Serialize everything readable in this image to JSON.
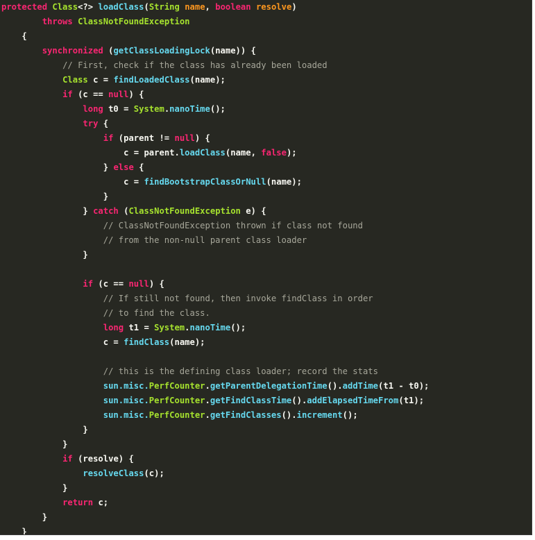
{
  "editor": {
    "lines": [
      [
        {
          "t": "protected ",
          "s": "k"
        },
        {
          "t": "Class",
          "s": "t"
        },
        {
          "t": "<?> ",
          "s": "d"
        },
        {
          "t": "loadClass",
          "s": "f"
        },
        {
          "t": "(",
          "s": "d"
        },
        {
          "t": "String ",
          "s": "t"
        },
        {
          "t": "name",
          "s": "p"
        },
        {
          "t": ", ",
          "s": "d"
        },
        {
          "t": "boolean ",
          "s": "k"
        },
        {
          "t": "resolve",
          "s": "p"
        },
        {
          "t": ")",
          "s": "d"
        }
      ],
      [
        {
          "t": "        ",
          "s": "d"
        },
        {
          "t": "throws ",
          "s": "k"
        },
        {
          "t": "ClassNotFoundException",
          "s": "t"
        }
      ],
      [
        {
          "t": "    {",
          "s": "d"
        }
      ],
      [
        {
          "t": "        ",
          "s": "d"
        },
        {
          "t": "synchronized ",
          "s": "k"
        },
        {
          "t": "(",
          "s": "d"
        },
        {
          "t": "getClassLoadingLock",
          "s": "f"
        },
        {
          "t": "(name)) {",
          "s": "d"
        }
      ],
      [
        {
          "t": "            ",
          "s": "d"
        },
        {
          "t": "// First, check if the class has already been loaded",
          "s": "c"
        }
      ],
      [
        {
          "t": "            ",
          "s": "d"
        },
        {
          "t": "Class ",
          "s": "t"
        },
        {
          "t": "c = ",
          "s": "d"
        },
        {
          "t": "findLoadedClass",
          "s": "f"
        },
        {
          "t": "(name);",
          "s": "d"
        }
      ],
      [
        {
          "t": "            ",
          "s": "d"
        },
        {
          "t": "if ",
          "s": "k"
        },
        {
          "t": "(c == ",
          "s": "d"
        },
        {
          "t": "null",
          "s": "k"
        },
        {
          "t": ") {",
          "s": "d"
        }
      ],
      [
        {
          "t": "                ",
          "s": "d"
        },
        {
          "t": "long ",
          "s": "k"
        },
        {
          "t": "t0 = ",
          "s": "d"
        },
        {
          "t": "System",
          "s": "t"
        },
        {
          "t": ".",
          "s": "d"
        },
        {
          "t": "nanoTime",
          "s": "f"
        },
        {
          "t": "();",
          "s": "d"
        }
      ],
      [
        {
          "t": "                ",
          "s": "d"
        },
        {
          "t": "try ",
          "s": "k"
        },
        {
          "t": "{",
          "s": "d"
        }
      ],
      [
        {
          "t": "                    ",
          "s": "d"
        },
        {
          "t": "if ",
          "s": "k"
        },
        {
          "t": "(parent != ",
          "s": "d"
        },
        {
          "t": "null",
          "s": "k"
        },
        {
          "t": ") {",
          "s": "d"
        }
      ],
      [
        {
          "t": "                        ",
          "s": "d"
        },
        {
          "t": "c = ",
          "s": "d"
        },
        {
          "t": "parent",
          "s": "d"
        },
        {
          "t": ".",
          "s": "d"
        },
        {
          "t": "loadClass",
          "s": "f"
        },
        {
          "t": "(name, ",
          "s": "d"
        },
        {
          "t": "false",
          "s": "k"
        },
        {
          "t": ");",
          "s": "d"
        }
      ],
      [
        {
          "t": "                    } ",
          "s": "d"
        },
        {
          "t": "else ",
          "s": "k"
        },
        {
          "t": "{",
          "s": "d"
        }
      ],
      [
        {
          "t": "                        ",
          "s": "d"
        },
        {
          "t": "c = ",
          "s": "d"
        },
        {
          "t": "findBootstrapClassOrNull",
          "s": "f"
        },
        {
          "t": "(name);",
          "s": "d"
        }
      ],
      [
        {
          "t": "                    }",
          "s": "d"
        }
      ],
      [
        {
          "t": "                } ",
          "s": "d"
        },
        {
          "t": "catch ",
          "s": "k"
        },
        {
          "t": "(",
          "s": "d"
        },
        {
          "t": "ClassNotFoundException ",
          "s": "t"
        },
        {
          "t": "e) {",
          "s": "d"
        }
      ],
      [
        {
          "t": "                    ",
          "s": "d"
        },
        {
          "t": "// ClassNotFoundException thrown if class not found",
          "s": "c"
        }
      ],
      [
        {
          "t": "                    ",
          "s": "d"
        },
        {
          "t": "// from the non-null parent class loader",
          "s": "c"
        }
      ],
      [
        {
          "t": "                }",
          "s": "d"
        }
      ],
      [
        {
          "t": "",
          "s": "d"
        }
      ],
      [
        {
          "t": "                ",
          "s": "d"
        },
        {
          "t": "if ",
          "s": "k"
        },
        {
          "t": "(c == ",
          "s": "d"
        },
        {
          "t": "null",
          "s": "k"
        },
        {
          "t": ") {",
          "s": "d"
        }
      ],
      [
        {
          "t": "                    ",
          "s": "d"
        },
        {
          "t": "// If still not found, then invoke findClass in order",
          "s": "c"
        }
      ],
      [
        {
          "t": "                    ",
          "s": "d"
        },
        {
          "t": "// to find the class.",
          "s": "c"
        }
      ],
      [
        {
          "t": "                    ",
          "s": "d"
        },
        {
          "t": "long ",
          "s": "k"
        },
        {
          "t": "t1 = ",
          "s": "d"
        },
        {
          "t": "System",
          "s": "t"
        },
        {
          "t": ".",
          "s": "d"
        },
        {
          "t": "nanoTime",
          "s": "f"
        },
        {
          "t": "();",
          "s": "d"
        }
      ],
      [
        {
          "t": "                    ",
          "s": "d"
        },
        {
          "t": "c = ",
          "s": "d"
        },
        {
          "t": "findClass",
          "s": "f"
        },
        {
          "t": "(name);",
          "s": "d"
        }
      ],
      [
        {
          "t": "",
          "s": "d"
        }
      ],
      [
        {
          "t": "                    ",
          "s": "d"
        },
        {
          "t": "// this is the defining class loader; record the stats",
          "s": "c"
        }
      ],
      [
        {
          "t": "                    ",
          "s": "d"
        },
        {
          "t": "sun.misc.",
          "s": "f"
        },
        {
          "t": "PerfCounter",
          "s": "t"
        },
        {
          "t": ".",
          "s": "d"
        },
        {
          "t": "getParentDelegationTime",
          "s": "f"
        },
        {
          "t": "().",
          "s": "d"
        },
        {
          "t": "addTime",
          "s": "f"
        },
        {
          "t": "(t1 - t0);",
          "s": "d"
        }
      ],
      [
        {
          "t": "                    ",
          "s": "d"
        },
        {
          "t": "sun.misc.",
          "s": "f"
        },
        {
          "t": "PerfCounter",
          "s": "t"
        },
        {
          "t": ".",
          "s": "d"
        },
        {
          "t": "getFindClassTime",
          "s": "f"
        },
        {
          "t": "().",
          "s": "d"
        },
        {
          "t": "addElapsedTimeFrom",
          "s": "f"
        },
        {
          "t": "(t1);",
          "s": "d"
        }
      ],
      [
        {
          "t": "                    ",
          "s": "d"
        },
        {
          "t": "sun.misc.",
          "s": "f"
        },
        {
          "t": "PerfCounter",
          "s": "t"
        },
        {
          "t": ".",
          "s": "d"
        },
        {
          "t": "getFindClasses",
          "s": "f"
        },
        {
          "t": "().",
          "s": "d"
        },
        {
          "t": "increment",
          "s": "f"
        },
        {
          "t": "();",
          "s": "d"
        }
      ],
      [
        {
          "t": "                }",
          "s": "d"
        }
      ],
      [
        {
          "t": "            }",
          "s": "d"
        }
      ],
      [
        {
          "t": "            ",
          "s": "d"
        },
        {
          "t": "if ",
          "s": "k"
        },
        {
          "t": "(resolve) {",
          "s": "d"
        }
      ],
      [
        {
          "t": "                ",
          "s": "d"
        },
        {
          "t": "resolveClass",
          "s": "f"
        },
        {
          "t": "(c);",
          "s": "d"
        }
      ],
      [
        {
          "t": "            }",
          "s": "d"
        }
      ],
      [
        {
          "t": "            ",
          "s": "d"
        },
        {
          "t": "return ",
          "s": "k"
        },
        {
          "t": "c;",
          "s": "d"
        }
      ],
      [
        {
          "t": "        }",
          "s": "d"
        }
      ],
      [
        {
          "t": "    }",
          "s": "d"
        }
      ]
    ]
  }
}
